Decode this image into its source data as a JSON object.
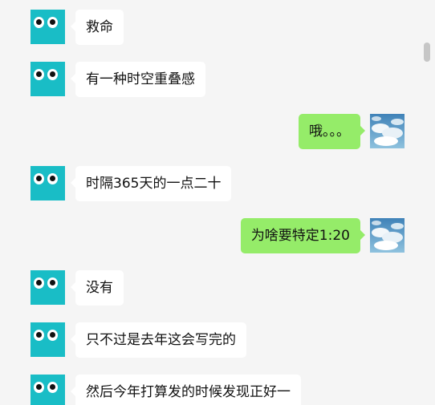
{
  "messages": [
    {
      "side": "left",
      "text": "救命",
      "avatar": "cartoon-eyes"
    },
    {
      "side": "left",
      "text": "有一种时空重叠感",
      "avatar": "cartoon-eyes"
    },
    {
      "side": "right",
      "text": "哦。。。",
      "avatar": "sky-clouds"
    },
    {
      "side": "left",
      "text": "时隔365天的一点二十",
      "avatar": "cartoon-eyes"
    },
    {
      "side": "right",
      "text": "为啥要特定1:20",
      "avatar": "sky-clouds"
    },
    {
      "side": "left",
      "text": "没有",
      "avatar": "cartoon-eyes"
    },
    {
      "side": "left",
      "text": "只不过是去年这会写完的",
      "avatar": "cartoon-eyes"
    },
    {
      "side": "left",
      "text": "然后今年打算发的时候发现正好一",
      "avatar": "cartoon-eyes"
    }
  ],
  "colors": {
    "background": "#f5f5f5",
    "incoming_bubble": "#ffffff",
    "outgoing_bubble": "#95ec69",
    "avatar_teal": "#19bdc6",
    "scrollbar": "#c6c6c6"
  }
}
